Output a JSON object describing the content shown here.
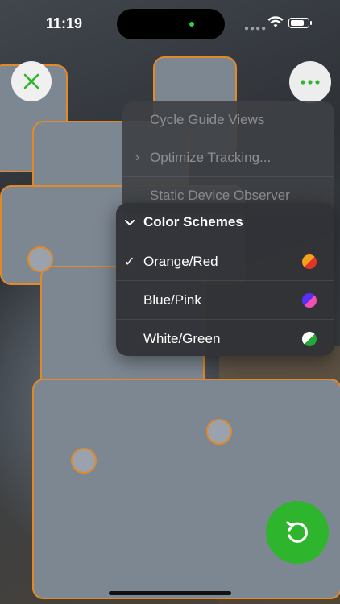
{
  "status_bar": {
    "time": "11:19"
  },
  "menu": {
    "items": [
      {
        "label": "Cycle Guide Views"
      },
      {
        "label": "Optimize Tracking..."
      },
      {
        "label": "Static Device Observer"
      }
    ],
    "submenu": {
      "title": "Color Schemes",
      "options": [
        {
          "label": "Orange/Red",
          "selected": true,
          "colors": [
            "#f5a11d",
            "#e3342b"
          ]
        },
        {
          "label": "Blue/Pink",
          "selected": false,
          "colors": [
            "#5a2ff5",
            "#f24fb1"
          ]
        },
        {
          "label": "White/Green",
          "selected": false,
          "colors": [
            "#ffffff",
            "#26a63a"
          ]
        }
      ]
    }
  },
  "colors": {
    "accent_green": "#2fb52d",
    "outline_orange": "#e08a2a"
  },
  "icons": {
    "close": "close-icon",
    "more": "ellipsis-icon",
    "reset": "reset-icon"
  }
}
